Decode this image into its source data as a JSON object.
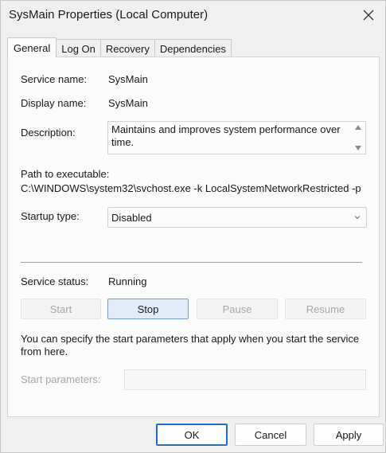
{
  "window": {
    "title": "SysMain Properties (Local Computer)"
  },
  "tabs": [
    {
      "label": "General"
    },
    {
      "label": "Log On"
    },
    {
      "label": "Recovery"
    },
    {
      "label": "Dependencies"
    }
  ],
  "general": {
    "service_name_label": "Service name:",
    "service_name": "SysMain",
    "display_name_label": "Display name:",
    "display_name": "SysMain",
    "description_label": "Description:",
    "description": "Maintains and improves system performance over time.",
    "path_label": "Path to executable:",
    "path": "C:\\WINDOWS\\system32\\svchost.exe -k LocalSystemNetworkRestricted -p",
    "startup_type_label": "Startup type:",
    "startup_type": "Disabled",
    "service_status_label": "Service status:",
    "service_status": "Running",
    "start_label": "Start",
    "stop_label": "Stop",
    "pause_label": "Pause",
    "resume_label": "Resume",
    "help_text": "You can specify the start parameters that apply when you start the service from here.",
    "start_params_label": "Start parameters:",
    "start_params_value": ""
  },
  "footer": {
    "ok_label": "OK",
    "cancel_label": "Cancel",
    "apply_label": "Apply"
  },
  "icons": {
    "close": "close-icon",
    "scroll_up": "scroll-up-icon",
    "scroll_down": "scroll-down-icon",
    "dropdown": "chevron-down-icon"
  },
  "colors": {
    "accent": "#1f6fc5",
    "primary_button_bg": "#e1ecf8"
  }
}
